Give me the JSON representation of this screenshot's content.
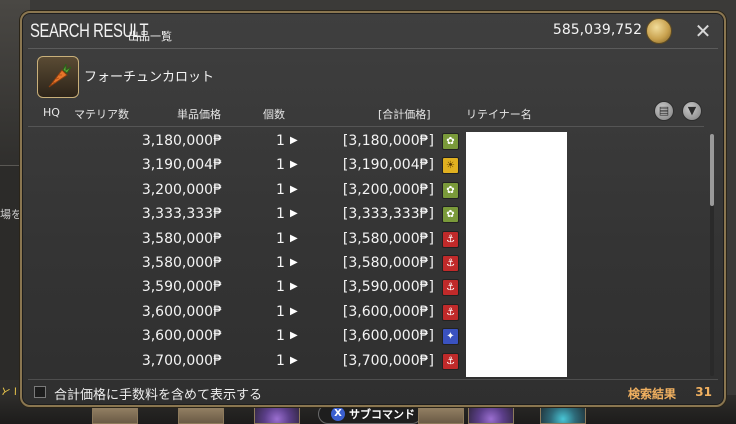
{
  "background": {
    "left_fragment": "場を",
    "left_fragment2": "とし",
    "subcommand_button": "サブコマンド",
    "subcommand_glyph": "X"
  },
  "window": {
    "title": "SEARCH RESULT",
    "subtitle": "出品一覧",
    "gil": "585,039,752",
    "close_glyph": "✕"
  },
  "item": {
    "name": "フォーチュンカロット",
    "icon": "carrot-icon"
  },
  "columns": {
    "hq": "HQ",
    "materia": "マテリア数",
    "unit_price": "単品価格",
    "quantity": "個数",
    "total": "[合計価格]",
    "retainer": "リテイナー名"
  },
  "listings": [
    {
      "price": "3,180,000₱",
      "qty": "1",
      "total": "[3,180,000₱]",
      "city": "gridania"
    },
    {
      "price": "3,190,004₱",
      "qty": "1",
      "total": "[3,190,004₱]",
      "city": "uldah"
    },
    {
      "price": "3,200,000₱",
      "qty": "1",
      "total": "[3,200,000₱]",
      "city": "gridania"
    },
    {
      "price": "3,333,333₱",
      "qty": "1",
      "total": "[3,333,333₱]",
      "city": "gridania"
    },
    {
      "price": "3,580,000₱",
      "qty": "1",
      "total": "[3,580,000₱]",
      "city": "limsa"
    },
    {
      "price": "3,580,000₱",
      "qty": "1",
      "total": "[3,580,000₱]",
      "city": "limsa"
    },
    {
      "price": "3,590,000₱",
      "qty": "1",
      "total": "[3,590,000₱]",
      "city": "limsa"
    },
    {
      "price": "3,600,000₱",
      "qty": "1",
      "total": "[3,600,000₱]",
      "city": "limsa"
    },
    {
      "price": "3,600,000₱",
      "qty": "1",
      "total": "[3,600,000₱]",
      "city": "ishgard"
    },
    {
      "price": "3,700,000₱",
      "qty": "1",
      "total": "[3,700,000₱]",
      "city": "limsa"
    }
  ],
  "city_colors": {
    "gridania": "#7a9a3a",
    "uldah": "#e0b020",
    "limsa": "#c02a2a",
    "ishgard": "#3a52c0"
  },
  "footer": {
    "checkbox_label": "合計価格に手数料を含めて表示する",
    "checkbox_checked": false,
    "result_label": "検索結果",
    "result_count": "31"
  }
}
